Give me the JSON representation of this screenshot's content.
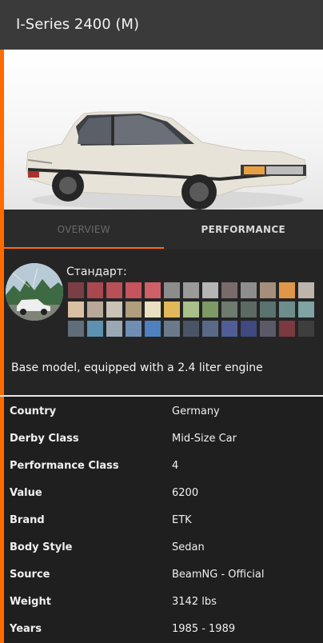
{
  "header": {
    "title": "I-Series 2400 (M)"
  },
  "tabs": [
    {
      "label": "OVERVIEW"
    },
    {
      "label": "PERFORMANCE"
    }
  ],
  "paint": {
    "label": "Стандарт:",
    "swatches": [
      "#7a3f45",
      "#a9484f",
      "#b85058",
      "#c6545e",
      "#cf6068",
      "#8c8c8c",
      "#9a9a9a",
      "#b5b5b5",
      "#7a6b6b",
      "#8e8e8e",
      "#a58f7c",
      "#e0964a",
      "#bdb5ac",
      "#d9c0a2",
      "#b8a898",
      "#c9c2b6",
      "#b09e7c",
      "#e8e0c0",
      "#e2b85a",
      "#a9c08a",
      "#7d9a66",
      "#6f7a70",
      "#5d6a64",
      "#5a7270",
      "#6e8e8c",
      "#7ea4a4",
      "#5f6e78",
      "#5a92b0",
      "#9aa7b5",
      "#6f8eb4",
      "#4f80c0",
      "#6a7a8a",
      "#4a5466",
      "#58698a",
      "#4f5e96",
      "#3f4a80",
      "#5a5a68",
      "#7a3a40",
      "#3e3e3e"
    ]
  },
  "description": "Base model, equipped with a 2.4 liter engine",
  "specs": [
    {
      "key": "Country",
      "value": "Germany"
    },
    {
      "key": "Derby Class",
      "value": "Mid-Size Car"
    },
    {
      "key": "Performance Class",
      "value": "4"
    },
    {
      "key": "Value",
      "value": "6200"
    },
    {
      "key": "Brand",
      "value": "ETK"
    },
    {
      "key": "Body Style",
      "value": "Sedan"
    },
    {
      "key": "Source",
      "value": "BeamNG - Official"
    },
    {
      "key": "Weight",
      "value": "3142 lbs"
    },
    {
      "key": "Years",
      "value": "1985 - 1989"
    }
  ],
  "colors": {
    "accent": "#ff6b00",
    "panel": "#1f1f1f",
    "header": "#3a3a3a"
  }
}
